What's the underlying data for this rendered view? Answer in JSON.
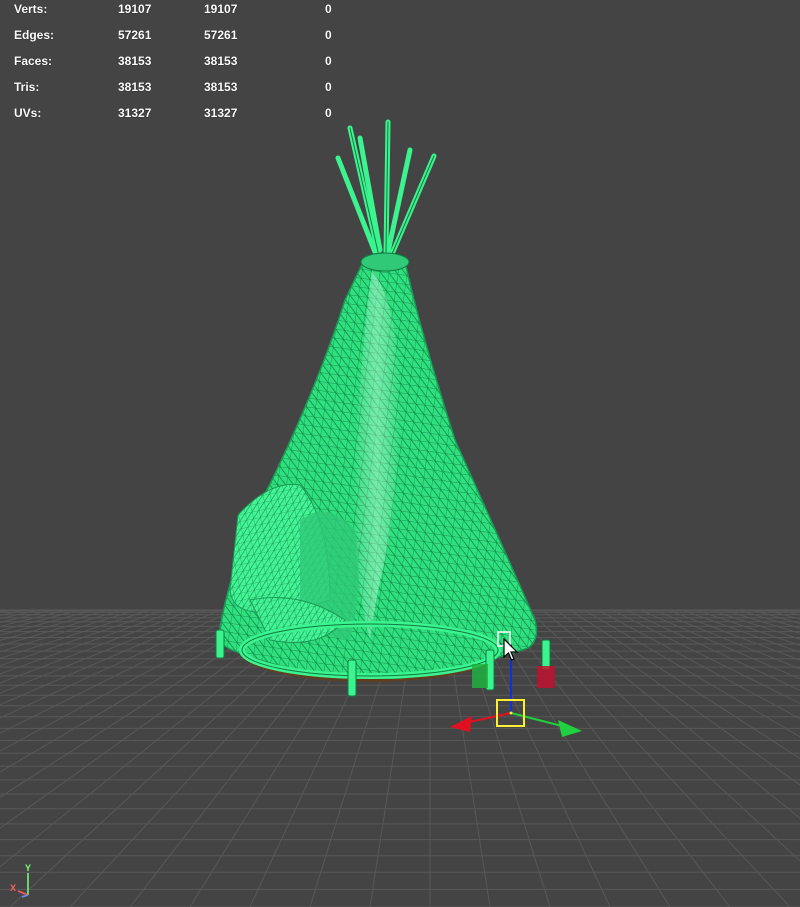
{
  "hud": {
    "rows": [
      {
        "label": "Verts:",
        "c1": "19107",
        "c2": "19107",
        "c3": "0"
      },
      {
        "label": "Edges:",
        "c1": "57261",
        "c2": "57261",
        "c3": "0"
      },
      {
        "label": "Faces:",
        "c1": "38153",
        "c2": "38153",
        "c3": "0"
      },
      {
        "label": "Tris:",
        "c1": "38153",
        "c2": "38153",
        "c3": "0"
      },
      {
        "label": "UVs:",
        "c1": "31327",
        "c2": "31327",
        "c3": "0"
      }
    ]
  },
  "axis_indicator": {
    "y_label": "Y",
    "x_label": "X"
  },
  "colors": {
    "background": "#444444",
    "grid": "#5a5a5a",
    "wireframe": "#3cf48f",
    "wireframe_dark": "#1a9a55",
    "mesh_fill": "#6b4a2a",
    "manip_x": "#e01020",
    "manip_y": "#1030e0",
    "manip_z": "#20d040",
    "manip_center": "#ffee33"
  }
}
